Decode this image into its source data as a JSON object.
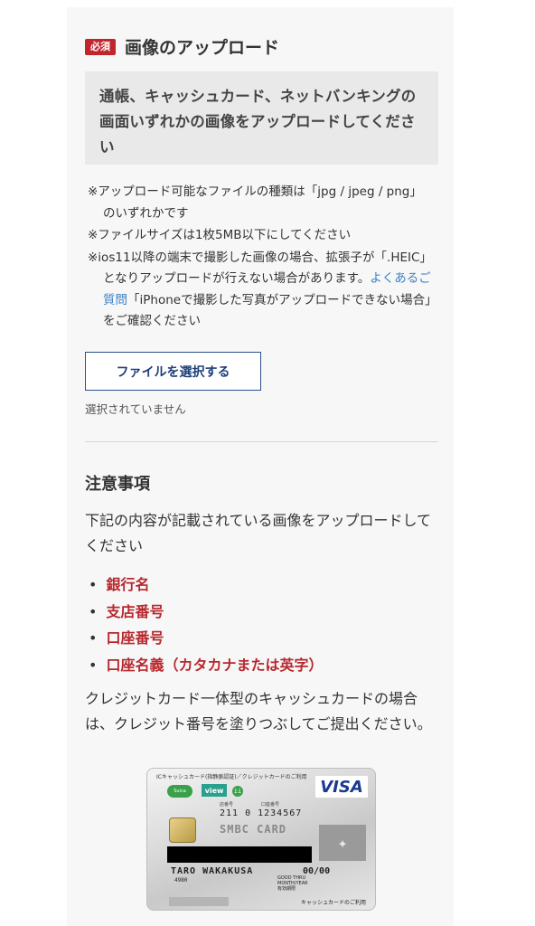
{
  "upload": {
    "required_badge": "必須",
    "title": "画像のアップロード",
    "instruction": "通帳、キャッシュカード、ネットバンキングの画面いずれかの画像をアップロードしてください",
    "notes": [
      "※アップロード可能なファイルの種類は「jpg / jpeg / png」のいずれかです",
      "※ファイルサイズは1枚5MB以下にしてください"
    ],
    "ios_note_prefix": "※ios11以降の端末で撮影した画像の場合、拡張子が「.HEIC」となりアップロードが行えない場合があります。",
    "faq_link": "よくあるご質問",
    "ios_note_suffix": "「iPhoneで撮影した写真がアップロードできない場合」をご確認ください",
    "file_button": "ファイルを選択する",
    "no_file_selected": "選択されていません"
  },
  "caution": {
    "title": "注意事項",
    "intro": "下記の内容が記載されている画像をアップロードしてください",
    "items": [
      "銀行名",
      "支店番号",
      "口座番号",
      "口座名義（カタカナまたは英字）"
    ],
    "credit_note": "クレジットカード一体型のキャッシュカードの場合は、クレジット番号を塗りつぶしてご提出ください。"
  },
  "card": {
    "header": "ICキャッシュカード(指静脈認証)／クレジットカードのご利用",
    "brand": "VISA",
    "suica_label": "Suica",
    "view_label": "view",
    "ic_label": "ii",
    "store_label": "店番号",
    "account_label": "口座番号",
    "numbers": "211  0  1234567",
    "bank_name": "SMBC CARD",
    "holder_name": "TARO WAKAKUSA",
    "small_code": "4980",
    "good_thru": "GOOD THRU",
    "month_year": "MONTH/YEAR",
    "valid_label": "有効期限",
    "expiry": "00/00",
    "footer": "キャッシュカードのご利用"
  },
  "colors": {
    "accent_red": "#c0272d",
    "link_blue": "#3e80c4",
    "button_border": "#2c4f8a"
  }
}
